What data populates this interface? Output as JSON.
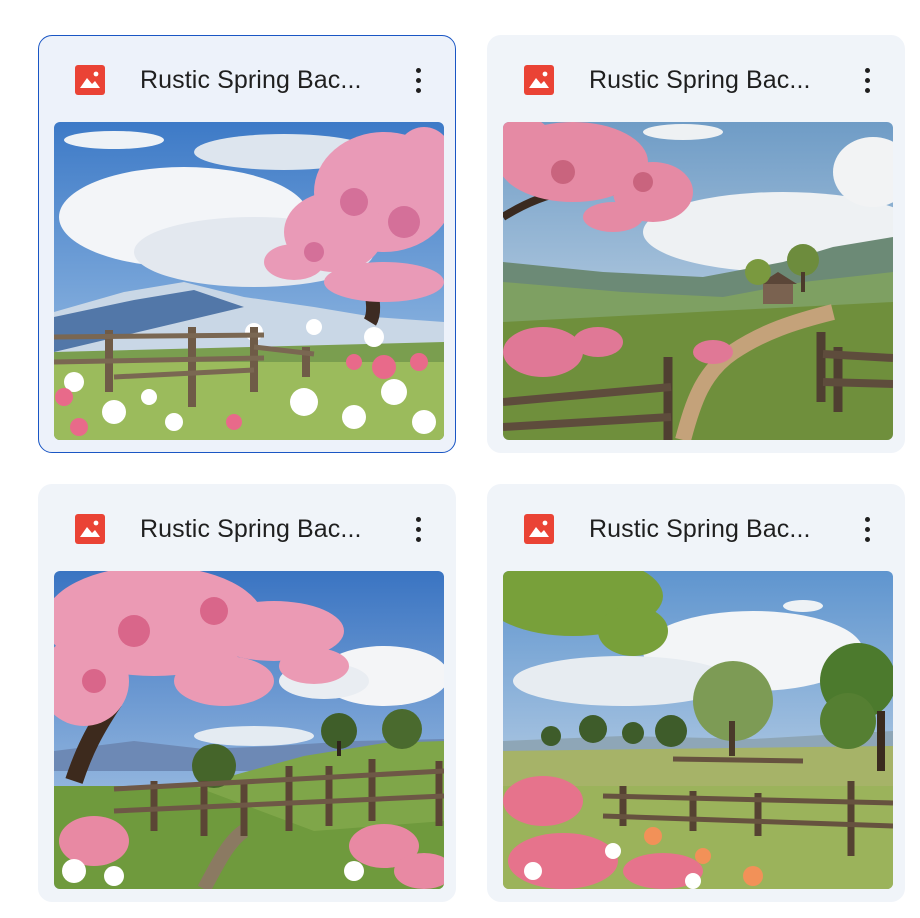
{
  "files": [
    {
      "title": "Rustic Spring Bac...",
      "icon": "image-file-icon",
      "selected": true
    },
    {
      "title": "Rustic Spring Bac...",
      "icon": "image-file-icon",
      "selected": false
    },
    {
      "title": "Rustic Spring Bac...",
      "icon": "image-file-icon",
      "selected": false
    },
    {
      "title": "Rustic Spring Bac...",
      "icon": "image-file-icon",
      "selected": false
    }
  ],
  "colors": {
    "icon_red": "#ea4335",
    "selection_border": "#1a56c4",
    "card_bg": "#f0f4f9"
  }
}
